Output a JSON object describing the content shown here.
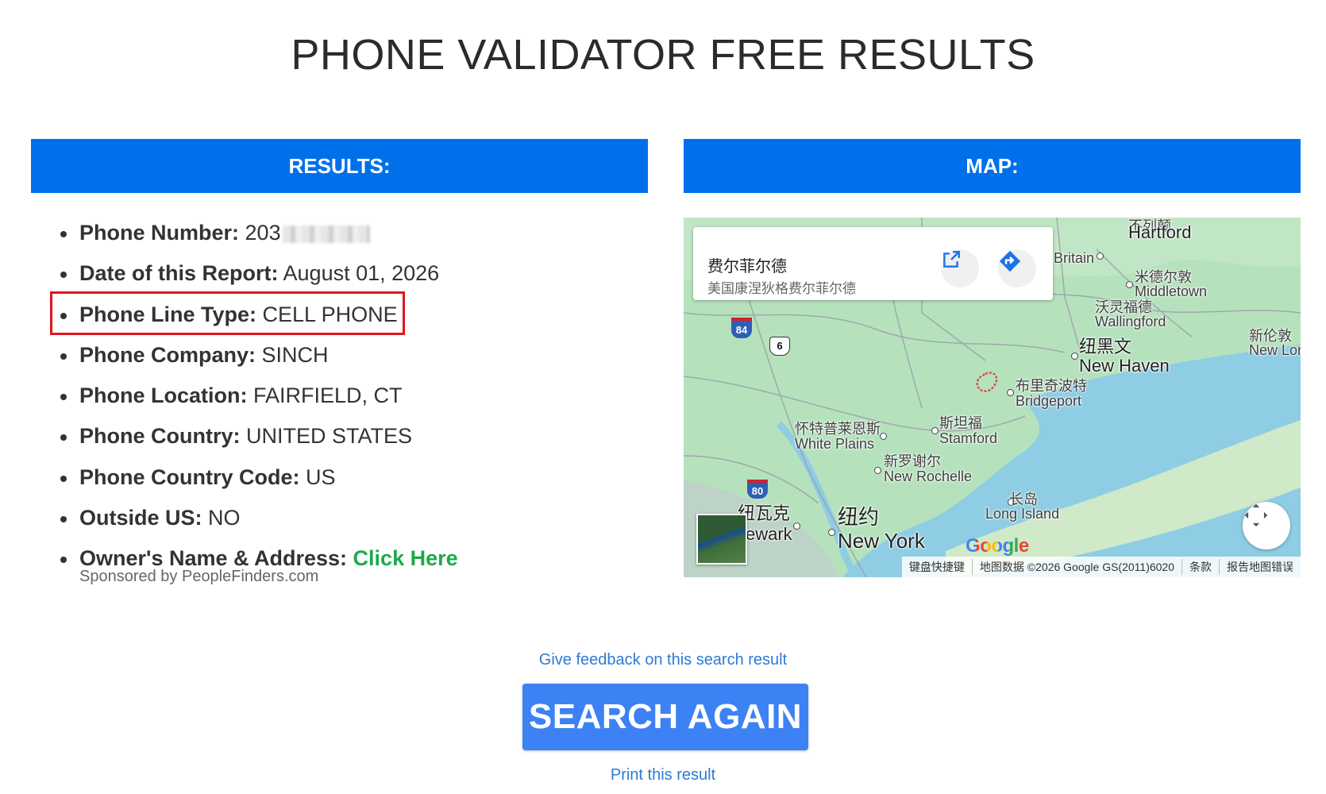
{
  "page": {
    "title": "PHONE VALIDATOR FREE RESULTS"
  },
  "results": {
    "header": "RESULTS:",
    "items": [
      {
        "label": "Phone Number:",
        "value": "203"
      },
      {
        "label": "Date of this Report:",
        "value": "August 01, 2026"
      },
      {
        "label": "Phone Line Type:",
        "value": "CELL PHONE"
      },
      {
        "label": "Phone Company:",
        "value": "SINCH"
      },
      {
        "label": "Phone Location:",
        "value": "FAIRFIELD, CT"
      },
      {
        "label": "Phone Country:",
        "value": "UNITED STATES"
      },
      {
        "label": "Phone Country Code:",
        "value": "US"
      },
      {
        "label": "Outside US:",
        "value": "NO"
      },
      {
        "label": "Owner's Name & Address:",
        "value": "Click Here"
      }
    ],
    "sponsor": "Sponsored by PeopleFinders.com"
  },
  "map": {
    "header": "MAP:",
    "card": {
      "title": "费尔菲尔德",
      "subtitle": "美国康涅狄格费尔菲尔德"
    },
    "labels": {
      "hartford": "Hartford",
      "new_britain_zh": "不列颠",
      "new_britain": "Britain",
      "middletown_zh": "米德尔敦",
      "middletown": "Middletown",
      "wallingford_zh": "沃灵福德",
      "wallingford": "Wallingford",
      "new_haven_zh": "纽黑文",
      "new_haven": "New Haven",
      "new_london_zh": "新伦敦",
      "new_london": "New Lor",
      "bridgeport_zh": "布里奇波特",
      "bridgeport": "Bridgeport",
      "stamford_zh": "斯坦福",
      "stamford": "Stamford",
      "white_plains_zh": "怀特普莱恩斯",
      "white_plains": "White Plains",
      "new_rochelle_zh": "新罗谢尔",
      "new_rochelle": "New Rochelle",
      "long_island_zh": "长岛",
      "long_island": "Long Island",
      "newark_zh": "纽瓦克",
      "newark": "ewark",
      "new_york_zh": "纽约",
      "new_york": "New York",
      "shield_84": "84",
      "shield_6": "6",
      "shield_80": "80",
      "google": "Google"
    },
    "attribution": [
      "键盘快捷键",
      "地图数据 ©2026 Google GS(2011)6020",
      "条款",
      "报告地图错误"
    ]
  },
  "actions": {
    "feedback": "Give feedback on this search result",
    "search_again": "SEARCH AGAIN",
    "print": "Print this result"
  },
  "colors": {
    "header_blue": "#0070ea",
    "button_blue": "#3d82f4",
    "link_green": "#1fa84b",
    "link_blue": "#2c7bd6",
    "highlight_red": "#e0161c"
  }
}
